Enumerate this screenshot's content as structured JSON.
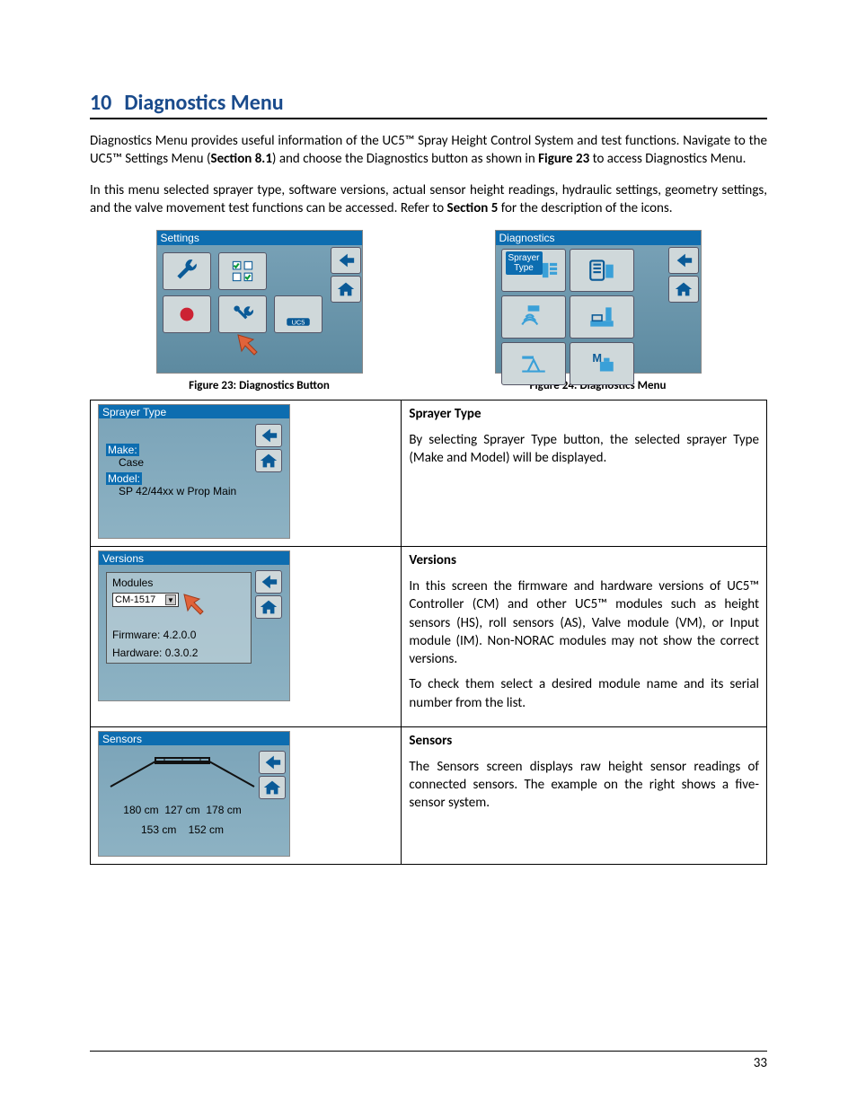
{
  "heading": {
    "number": "10",
    "title": "Diagnostics Menu"
  },
  "para1_a": "Diagnostics Menu provides useful information of the UC5™ Spray Height Control System and test functions. Navigate to the UC5™ Settings Menu (",
  "para1_b": "Section 8.1",
  "para1_c": ") and choose the Diagnostics button as shown in ",
  "para1_d": "Figure 23",
  "para1_e": " to access Diagnostics Menu.",
  "para2_a": "In this menu selected sprayer type, software versions, actual sensor height readings, hydraulic settings, geometry settings, and the valve movement test functions can be accessed. Refer to ",
  "para2_b": "Section 5",
  "para2_c": " for the description of the icons.",
  "fig23": {
    "title": "Settings",
    "caption": "Figure 23: Diagnostics Button"
  },
  "fig24": {
    "title": "Diagnostics",
    "sprayer_type_label": "Sprayer\nType",
    "caption": "Figure 24: Diagnostics Menu"
  },
  "row1": {
    "screen_title": "Sprayer Type",
    "make_label": "Make:",
    "make_value": "Case",
    "model_label": "Model:",
    "model_value": "SP 42/44xx w Prop Main",
    "heading": "Sprayer Type",
    "body": "By selecting Sprayer Type button, the selected sprayer Type (Make and Model) will be displayed."
  },
  "row2": {
    "screen_title": "Versions",
    "modules_label": "Modules",
    "module_value": "CM-1517",
    "firmware": "Firmware: 4.2.0.0",
    "hardware": "Hardware: 0.3.0.2",
    "heading": "Versions",
    "body1": "In this screen the firmware and hardware versions of UC5™ Controller (CM) and other UC5™ modules such as height sensors (HS), roll sensors (AS), Valve module (VM), or Input module (IM).  Non-NORAC modules may not show the correct versions.",
    "body2": "To check them select a desired module name and its serial number from the list."
  },
  "row3": {
    "screen_title": "Sensors",
    "s1": "180 cm",
    "s2": "127 cm",
    "s3": "178 cm",
    "s4": "153 cm",
    "s5": "152 cm",
    "heading": "Sensors",
    "body": "The Sensors screen displays raw height sensor readings of connected sensors. The example on the right shows a five-sensor system."
  },
  "page_number": "33"
}
